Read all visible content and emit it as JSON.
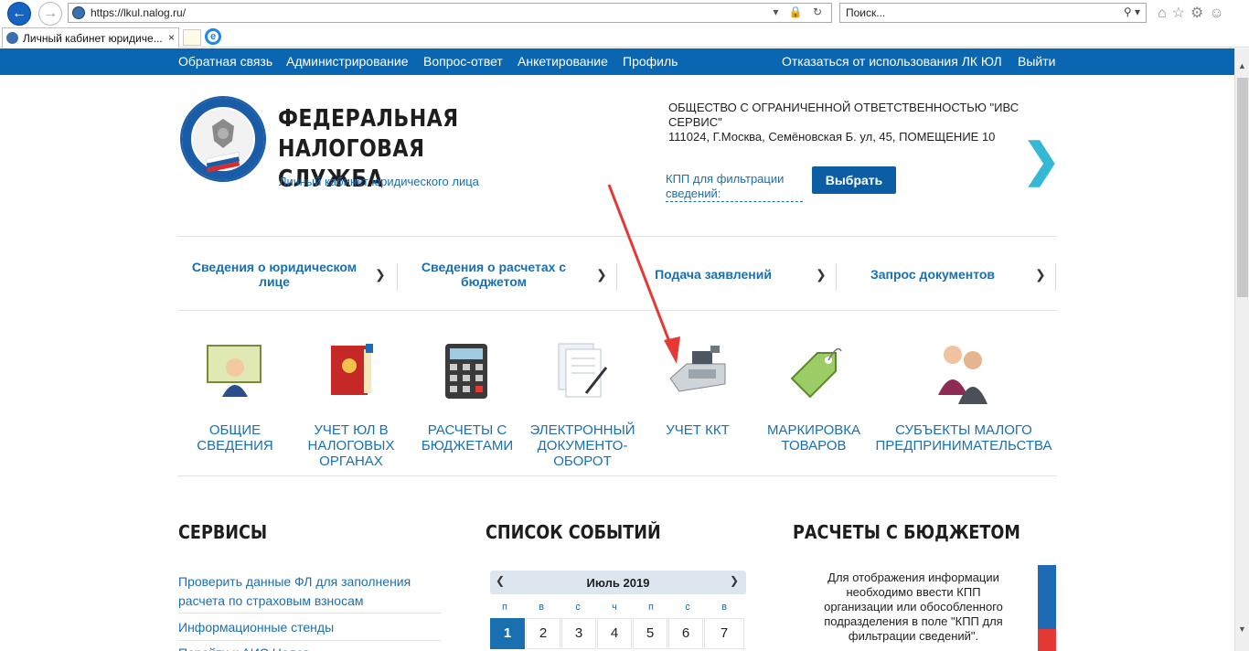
{
  "browser": {
    "url": "https://lkul.nalog.ru/",
    "search_placeholder": "Поиск...",
    "tab_title": "Личный кабинет юридиче...",
    "tab_close": "×"
  },
  "topnav": {
    "items": [
      "Обратная связь",
      "Администрирование",
      "Вопрос-ответ",
      "Анкетирование",
      "Профиль"
    ],
    "refuse": "Отказаться от использования ЛК ЮЛ",
    "logout": "Выйти"
  },
  "header": {
    "title_line1": "ФЕДЕРАЛЬНАЯ",
    "title_line2": "НАЛОГОВАЯ СЛУЖБА",
    "subtitle": "Личный кабинет юридического лица",
    "org_name": "ОБЩЕСТВО С ОГРАНИЧЕННОЙ ОТВЕТСТВЕННОСТЬЮ \"ИВС СЕРВИС\"",
    "org_address": "111024, Г.Москва, Семёновская Б. ул, 45, ПОМЕЩЕНИЕ 10",
    "kpp_label": "КПП для фильтрации сведений:",
    "choose_button": "Выбрать"
  },
  "menu": [
    "Сведения о юридическом лице",
    "Сведения о расчетах с бюджетом",
    "Подача заявлений",
    "Запрос документов"
  ],
  "tiles": [
    {
      "label": "ОБЩИЕ СВЕДЕНИЯ",
      "icon": "person-board-icon"
    },
    {
      "label": "УЧЕТ ЮЛ В НАЛОГОВЫХ ОРГАНАХ",
      "icon": "red-folder-icon"
    },
    {
      "label": "РАСЧЕТЫ С БЮДЖЕТАМИ",
      "icon": "calculator-icon"
    },
    {
      "label": "ЭЛЕКТРОННЫЙ ДОКУМЕНТО-ОБОРОТ",
      "icon": "documents-pen-icon"
    },
    {
      "label": "УЧЕТ ККТ",
      "icon": "cash-register-icon"
    },
    {
      "label": "МАРКИРОВКА ТОВАРОВ",
      "icon": "tag-icon"
    },
    {
      "label": "СУБЪЕКТЫ МАЛОГО ПРЕДПРИНИМАТЕЛЬСТВА",
      "icon": "business-people-icon"
    }
  ],
  "sections": {
    "services_title": "СЕРВИСЫ",
    "events_title": "СПИСОК СОБЫТИЙ",
    "budget_title": "РАСЧЕТЫ С БЮДЖЕТОМ",
    "services": [
      "Проверить данные ФЛ для заполнения расчета по страховым взносам",
      "Информационные стенды",
      "Перейти к АИС Налог"
    ],
    "budget_text": "Для отображения информации необходимо ввести КПП организации или обособленного подразделения в поле \"КПП для фильтрации сведений\"."
  },
  "calendar": {
    "month": "Июль 2019",
    "weekdays": [
      "п",
      "в",
      "с",
      "ч",
      "п",
      "с",
      "в"
    ],
    "days": [
      "1",
      "2",
      "3",
      "4",
      "5",
      "6",
      "7"
    ],
    "selected": "1"
  },
  "colors": {
    "nav_blue": "#0b66b2",
    "link_blue": "#1a6fb0",
    "arrow_red": "#e53935",
    "accent_cyan": "#35b7d6"
  }
}
